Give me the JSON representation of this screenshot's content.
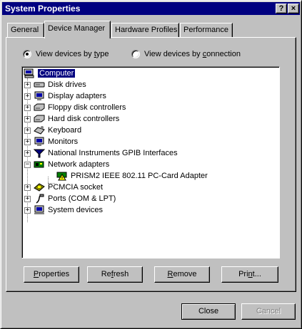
{
  "window": {
    "title": "System Properties",
    "help_glyph": "?",
    "close_glyph": "×"
  },
  "tabs": [
    {
      "label": "General",
      "active": false
    },
    {
      "label": "Device Manager",
      "active": true
    },
    {
      "label": "Hardware Profiles",
      "active": false
    },
    {
      "label": "Performance",
      "active": false
    }
  ],
  "view_options": {
    "by_type": {
      "pre": "View devices by ",
      "key": "t",
      "post": "ype",
      "checked": true
    },
    "by_connection": {
      "pre": "View devices by ",
      "key": "c",
      "post": "onnection",
      "checked": false
    }
  },
  "tree": {
    "root": {
      "label": "Computer",
      "icon": "computer-icon"
    },
    "items": [
      {
        "label": "Disk drives",
        "icon": "disk-drive-icon",
        "expander": "+"
      },
      {
        "label": "Display adapters",
        "icon": "monitor-icon",
        "expander": "+"
      },
      {
        "label": "Floppy disk controllers",
        "icon": "controller-icon",
        "expander": "+"
      },
      {
        "label": "Hard disk controllers",
        "icon": "controller-icon",
        "expander": "+"
      },
      {
        "label": "Keyboard",
        "icon": "keyboard-icon",
        "expander": "+"
      },
      {
        "label": "Monitors",
        "icon": "monitor-icon",
        "expander": "+"
      },
      {
        "label": "National Instruments GPIB Interfaces",
        "icon": "gpib-icon",
        "expander": "+"
      },
      {
        "label": "Network adapters",
        "icon": "network-card-icon",
        "expander": "−"
      },
      {
        "label": "PCMCIA socket",
        "icon": "pcmcia-icon",
        "expander": "+"
      },
      {
        "label": "Ports (COM & LPT)",
        "icon": "port-icon",
        "expander": "+"
      },
      {
        "label": "System devices",
        "icon": "system-device-icon",
        "expander": "+"
      }
    ],
    "child": {
      "label": "PRISM2 IEEE 802.11 PC-Card Adapter",
      "icon": "warning-card-icon"
    }
  },
  "buttons": {
    "properties": {
      "pre": "",
      "key": "P",
      "post": "roperties"
    },
    "refresh": {
      "pre": "Re",
      "key": "f",
      "post": "resh"
    },
    "remove": {
      "pre": "",
      "key": "R",
      "post": "emove"
    },
    "print": {
      "pre": "Pri",
      "key": "n",
      "post": "t..."
    },
    "close": "Close",
    "cancel": "Cancel"
  },
  "colors": {
    "selection": "#000080",
    "titlebar": "#000080",
    "face": "#c0c0c0"
  }
}
